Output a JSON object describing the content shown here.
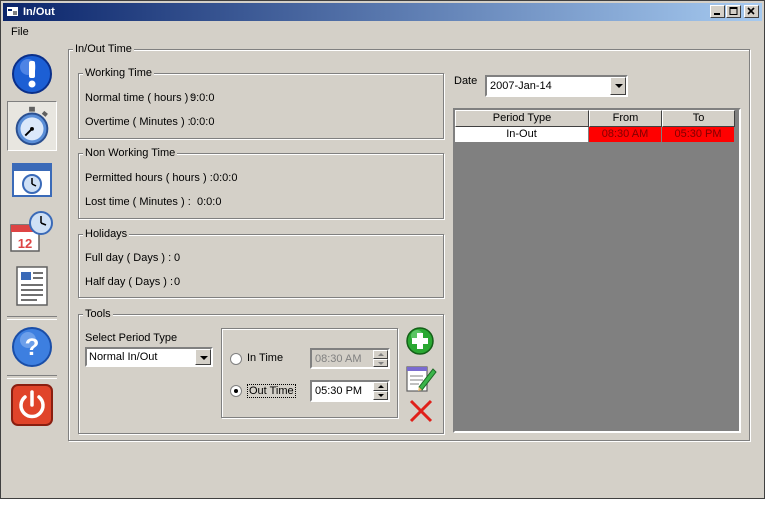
{
  "window": {
    "title": "In/Out"
  },
  "menu": {
    "file": "File"
  },
  "nav": {
    "items": [
      {
        "name": "alert-icon"
      },
      {
        "name": "stopwatch-icon"
      },
      {
        "name": "calendar-clock-icon"
      },
      {
        "name": "calendar-12-icon"
      },
      {
        "name": "report-icon"
      },
      {
        "name": "help-icon"
      },
      {
        "name": "power-icon"
      }
    ]
  },
  "main": {
    "group_title": "In/Out Time"
  },
  "working_time": {
    "title": "Working Time",
    "normal_label": "Normal time ( hours ) :",
    "normal_value": "9:0:0",
    "overtime_label": "Overtime ( Minutes ) :",
    "overtime_value": "0:0:0"
  },
  "non_working_time": {
    "title": "Non Working Time",
    "permitted_label": "Permitted hours ( hours ) :",
    "permitted_value": "0:0:0",
    "lost_label": "Lost time ( Minutes ) :",
    "lost_value": "0:0:0"
  },
  "holidays": {
    "title": "Holidays",
    "full_label": "Full day ( Days ) :",
    "full_value": "0",
    "half_label": "Half day ( Days ) :",
    "half_value": "0"
  },
  "tools": {
    "title": "Tools",
    "period_type_label": "Select Period Type",
    "period_type_value": "Normal In/Out",
    "in_time_label": "In Time",
    "in_time_value": "08:30 AM",
    "out_time_label": "Out Time",
    "out_time_value": "05:30 PM",
    "selected": "out"
  },
  "date": {
    "label": "Date",
    "value": "2007-Jan-14"
  },
  "table": {
    "columns": [
      "Period Type",
      "From",
      "To"
    ],
    "rows": [
      {
        "period_type": "In-Out",
        "from": "08:30 AM",
        "to": "05:30 PM"
      }
    ],
    "highlight_color": "#ff0000"
  },
  "colors": {
    "title_start": "#0a246a",
    "title_end": "#a6caf0",
    "face": "#d4d0c8"
  }
}
